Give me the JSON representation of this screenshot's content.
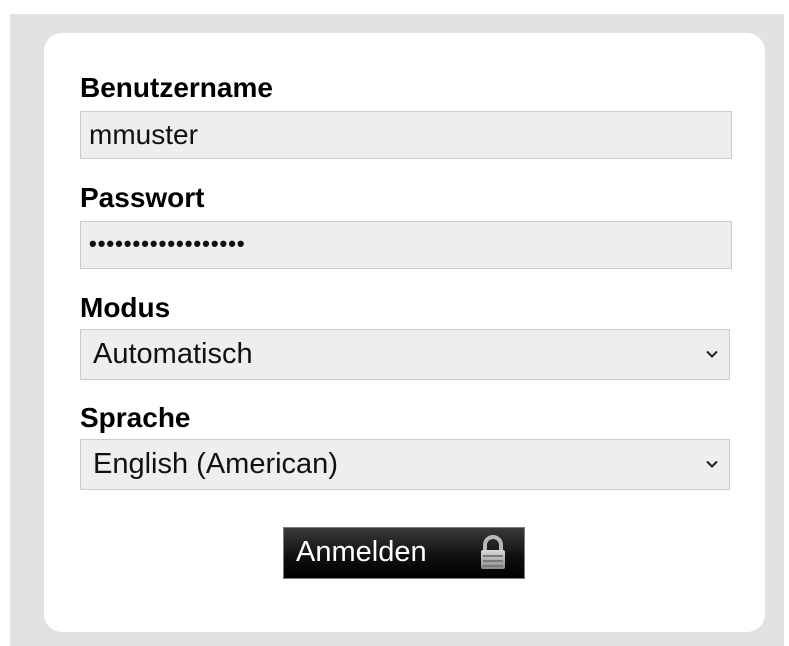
{
  "form": {
    "username": {
      "label": "Benutzername",
      "value": "mmuster"
    },
    "password": {
      "label": "Passwort",
      "masked_value": "••••••••••••••••••"
    },
    "mode": {
      "label": "Modus",
      "selected": "Automatisch"
    },
    "language": {
      "label": "Sprache",
      "selected": "English (American)"
    },
    "submit": {
      "label": "Anmelden",
      "icon": "lock-icon"
    }
  },
  "colors": {
    "background": "#e2e2e2",
    "card": "#ffffff",
    "input": "#eceeef",
    "button": "#000000"
  }
}
